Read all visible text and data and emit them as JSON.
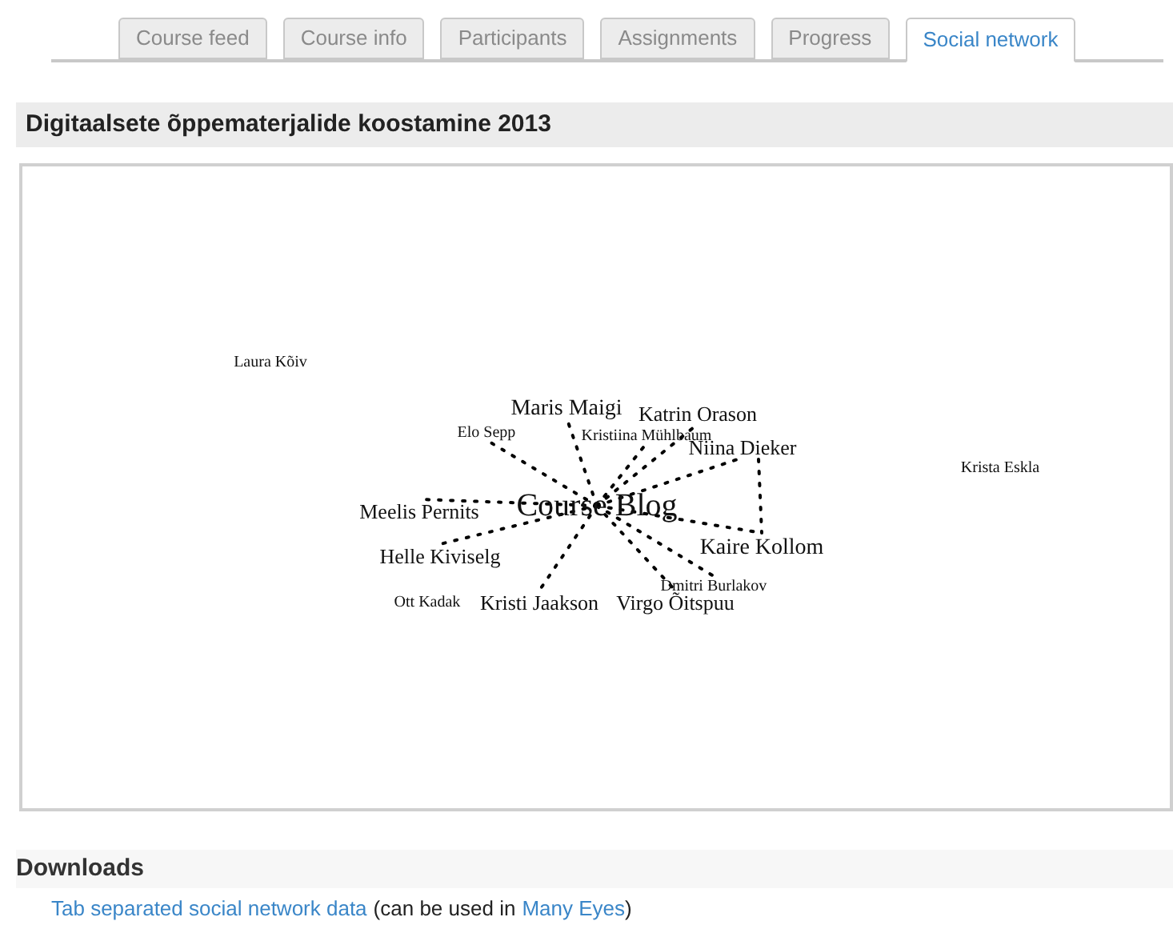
{
  "tabs": [
    {
      "label": "Course feed",
      "selected": false
    },
    {
      "label": "Course info",
      "selected": false
    },
    {
      "label": "Participants",
      "selected": false
    },
    {
      "label": "Assignments",
      "selected": false
    },
    {
      "label": "Progress",
      "selected": false
    },
    {
      "label": "Social network",
      "selected": true
    }
  ],
  "title": "Digitaalsete õppematerjalide koostamine 2013",
  "graph": {
    "nodes": [
      {
        "label": "Laura Kõiv",
        "kind": "isolated"
      },
      {
        "label": "Maris Maigi",
        "kind": "linked"
      },
      {
        "label": "Katrin Orason",
        "kind": "linked"
      },
      {
        "label": "Elo Sepp",
        "kind": "linked"
      },
      {
        "label": "Kristiina Mühlbaum",
        "kind": "linked"
      },
      {
        "label": "Niina Dieker",
        "kind": "relay"
      },
      {
        "label": "Krista Eskla",
        "kind": "isolated"
      },
      {
        "label": "Course Blog",
        "kind": "hub"
      },
      {
        "label": "Meelis Pernits",
        "kind": "linked"
      },
      {
        "label": "Kaire Kollom",
        "kind": "chained"
      },
      {
        "label": "Helle Kiviselg",
        "kind": "linked"
      },
      {
        "label": "Dmitri Burlakov",
        "kind": "linked"
      },
      {
        "label": "Ott Kadak",
        "kind": "isolated"
      },
      {
        "label": "Kristi Jaakson",
        "kind": "linked"
      },
      {
        "label": "Virgo Õitspuu",
        "kind": "linked"
      }
    ]
  },
  "downloads": {
    "heading": "Downloads",
    "link": "Tab separated social network data",
    "note_before": "(can be used in",
    "note_link": "Many Eyes",
    "note_after": ")"
  }
}
